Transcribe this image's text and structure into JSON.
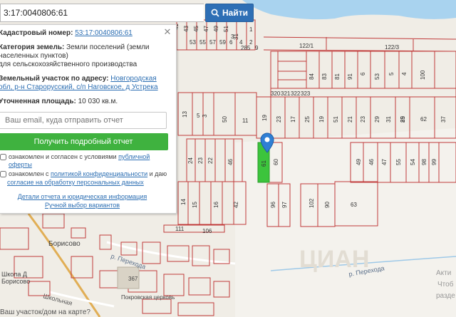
{
  "search": {
    "value": "3:17:0040806:61",
    "button_label": "Найти"
  },
  "panel": {
    "cadastral_label": "Кадастровый номер:",
    "cadastral_value": "53:17:0040806:61",
    "category_label": "Категория земель:",
    "category_value": "Земли поселений (земли населенных пунктов)",
    "category_note": "для сельскохозяйственного производства",
    "address_label": "Земельный участок по адресу:",
    "address_value": "Новгородская обл, р-н Старорусский, с/п Наговское, д Устрека",
    "area_label": "Уточненная площадь:",
    "area_value": "10 030 кв.м.",
    "email_placeholder": "Ваш email, куда отправить отчет",
    "report_button": "Получить подробный отчет",
    "agree1_text": "ознакомлен и согласен с условиями",
    "agree1_link": "публичной оферты",
    "agree2_text": "ознакомлен с",
    "agree2_link": "политикой конфиденциальности",
    "agree2_text2": "и даю",
    "agree2_link2": "согласие на обработку персональных данных",
    "details_link": "Детали отчета и юридическая информация",
    "manual_link": "Ручной выбор вариантов"
  },
  "hint": "Ваш участок/дом на карте?",
  "map": {
    "parcel_labels": [
      "41",
      "43",
      "45",
      "47",
      "49",
      "51",
      "53",
      "55",
      "57",
      "59",
      "6",
      "4",
      "2",
      "31",
      "1",
      "3",
      "285",
      "9",
      "122/1",
      "122/3",
      "84",
      "83",
      "81",
      "91",
      "6",
      "53",
      "5",
      "4",
      "100",
      "320",
      "321",
      "322",
      "323",
      "19",
      "23",
      "17",
      "25",
      "19",
      "51",
      "21",
      "23",
      "29",
      "31",
      "25",
      "89",
      "62",
      "37",
      "13",
      "5",
      "3",
      "50",
      "11",
      "24",
      "23",
      "22",
      "46",
      "61",
      "60",
      "49",
      "46",
      "47",
      "55",
      "54",
      "98",
      "99",
      "14",
      "42",
      "16",
      "15",
      "96",
      "97",
      "102",
      "90",
      "63",
      "111",
      "106"
    ],
    "road_labels": [
      "р. Перехода",
      "р. Перехода",
      "Школьная"
    ],
    "place_labels": [
      "Борисово",
      "Школа Д",
      "Борисово",
      "367",
      "Покровская церковь",
      "Акти",
      "Чтоб",
      "разде"
    ],
    "watermark": "ЦИАН",
    "selected_parcel": "61"
  },
  "colors": {
    "map_bg": "#f0ede6",
    "water": "#a9d3ef",
    "parcel_line": "#c13a3a",
    "selected_parcel": "#3cc43c",
    "marker": "#2f7fd4",
    "button_blue": "#2e6fb5",
    "button_green": "#3fb23f",
    "link": "#2d6fb3"
  }
}
